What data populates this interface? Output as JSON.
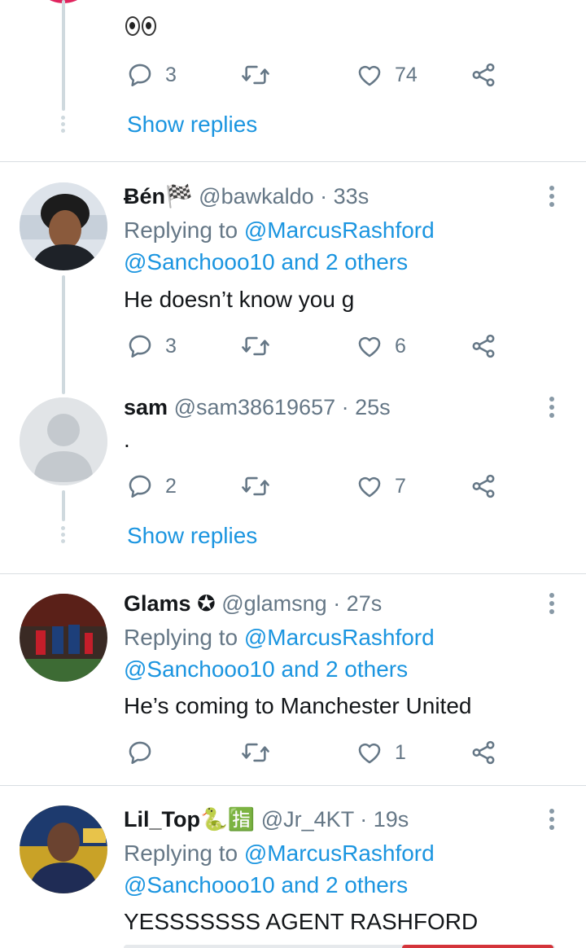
{
  "top_tweet": {
    "text": "👀",
    "reply_count": "3",
    "like_count": "74",
    "show_replies": "Show replies"
  },
  "tweets": [
    {
      "name": "Ƀén🏁",
      "handle": "@bawkaldo",
      "time": "· 33s",
      "replying_prefix": "Replying to",
      "replying_user": "@MarcusRashford",
      "replying_others": "@Sanchooo10 and 2 others",
      "text": "He doesn’t know you g",
      "reply_count": "3",
      "like_count": "6"
    },
    {
      "name": "sam",
      "handle": "@sam38619657",
      "time": "· 25s",
      "text": ".",
      "reply_count": "2",
      "like_count": "7",
      "show_replies": "Show replies"
    },
    {
      "name": "Glams",
      "name_badge": "✪",
      "handle": "@glamsng",
      "time": "· 27s",
      "replying_prefix": "Replying to",
      "replying_user": "@MarcusRashford",
      "replying_others": "@Sanchooo10 and 2 others",
      "text": "He’s coming to Manchester United",
      "reply_count": "",
      "like_count": "1"
    },
    {
      "name": "Lil_Top🐍🈯",
      "handle": "@Jr_4KT",
      "time": "· 19s",
      "replying_prefix": "Replying to",
      "replying_user": "@MarcusRashford",
      "replying_others": "@Sanchooo10 and 2 others",
      "text": "YESSSSSSS AGENT RASHFORD"
    }
  ],
  "icons": {
    "reply": "reply-icon",
    "retweet": "retweet-icon",
    "like": "heart-icon",
    "share": "share-icon",
    "more": "more-vertical-icon"
  },
  "colors": {
    "link": "#1b95e0",
    "secondary_text": "#657786",
    "thread_line": "#cfd9de",
    "separator": "#d9dee2"
  }
}
